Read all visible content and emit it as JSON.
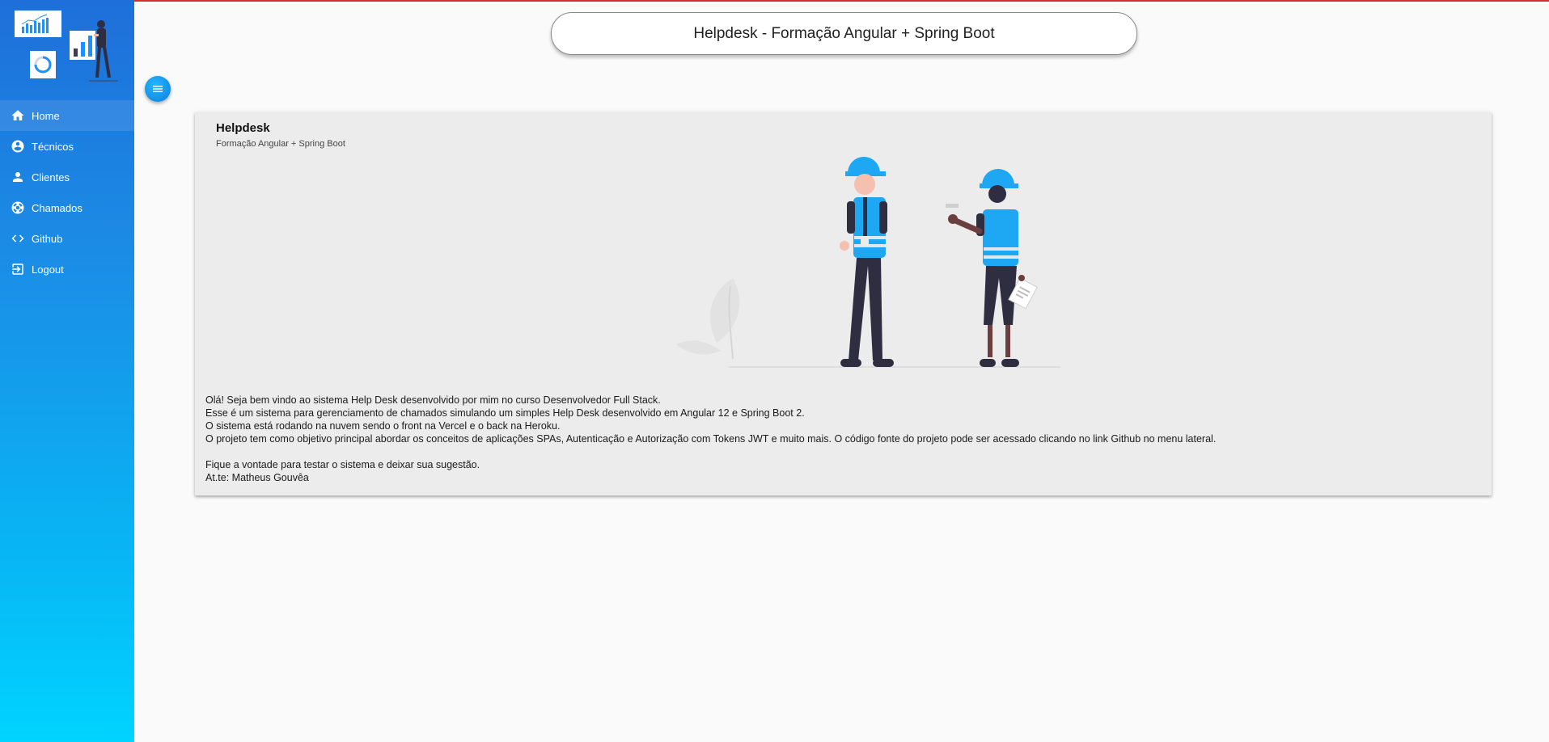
{
  "window": {
    "title": "Helpdesk - Formação Angular + Spring Boot"
  },
  "sidebar": {
    "items": [
      {
        "label": "Home",
        "icon": "home-icon",
        "active": true
      },
      {
        "label": "Técnicos",
        "icon": "account-circle-icon"
      },
      {
        "label": "Clientes",
        "icon": "person-icon"
      },
      {
        "label": "Chamados",
        "icon": "lifebuoy-icon"
      },
      {
        "label": "Github",
        "icon": "code-icon"
      },
      {
        "label": "Logout",
        "icon": "logout-icon"
      }
    ]
  },
  "menu_toggle": {
    "icon": "menu-icon"
  },
  "card": {
    "title": "Helpdesk",
    "subtitle": "Formação Angular + Spring Boot",
    "lines": [
      "Olá! Seja bem vindo ao sistema Help Desk desenvolvido por mim no curso Desenvolvedor Full Stack.",
      "Esse é um sistema para gerenciamento de chamados simulando um simples Help Desk desenvolvido em Angular 12 e Spring Boot 2.",
      "O sistema está rodando na nuvem sendo o front na Vercel e o back na Heroku.",
      "O projeto tem como objetivo principal abordar os conceitos de aplicações SPAs, Autenticação e Autorização com Tokens JWT e muito mais. O código fonte do projeto pode ser acessado clicando no link Github no menu lateral."
    ],
    "closing": [
      "Fique a vontade para testar o sistema e deixar sua sugestão.",
      "At.te: Matheus Gouvêa"
    ]
  },
  "colors": {
    "sidebar_top": "#1e6fd9",
    "sidebar_bottom": "#00d4ff",
    "accent": "#1ea7f2",
    "top_line": "#d32f2f"
  }
}
